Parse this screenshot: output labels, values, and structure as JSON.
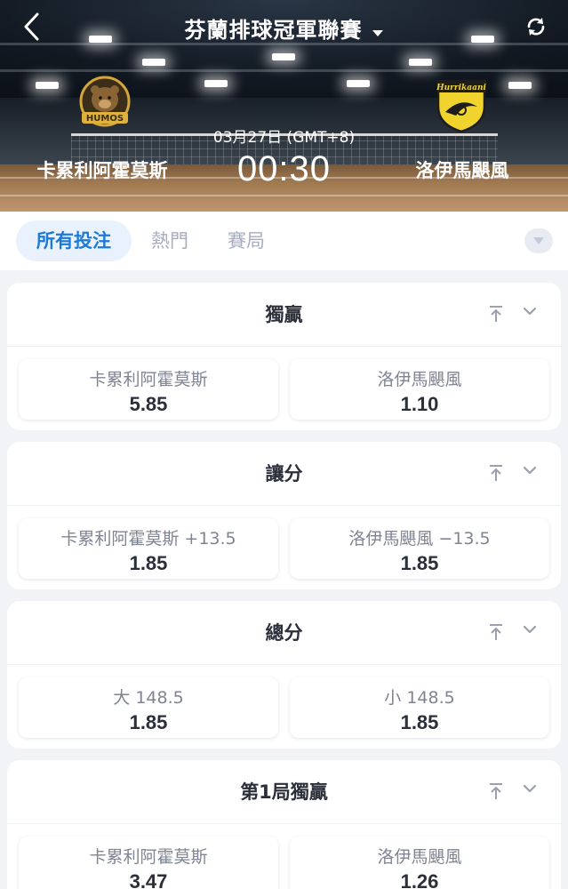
{
  "header": {
    "league_title": "芬蘭排球冠軍聯賽",
    "match_date": "03月27日 (GMT+8)",
    "match_time": "00:30",
    "home_team": "卡累利阿霍莫斯",
    "away_team": "洛伊馬颶風",
    "home_logo_text": "HUMOS",
    "away_logo_text": "Hurrikaani"
  },
  "tabs": [
    {
      "label": "所有投注",
      "active": true
    },
    {
      "label": "熱門",
      "active": false
    },
    {
      "label": "賽局",
      "active": false
    }
  ],
  "markets": [
    {
      "title": "獨贏",
      "options": [
        {
          "label": "卡累利阿霍莫斯",
          "odds": "5.85"
        },
        {
          "label": "洛伊馬颶風",
          "odds": "1.10"
        }
      ]
    },
    {
      "title": "讓分",
      "options": [
        {
          "label": "卡累利阿霍莫斯 +13.5",
          "odds": "1.85"
        },
        {
          "label": "洛伊馬颶風 −13.5",
          "odds": "1.85"
        }
      ]
    },
    {
      "title": "總分",
      "options": [
        {
          "label": "大 148.5",
          "odds": "1.85"
        },
        {
          "label": "小 148.5",
          "odds": "1.85"
        }
      ]
    },
    {
      "title": "第1局獨贏",
      "options": [
        {
          "label": "卡累利阿霍莫斯",
          "odds": "3.47"
        },
        {
          "label": "洛伊馬颶風",
          "odds": "1.26"
        }
      ]
    }
  ],
  "colors": {
    "accent": "#1d79d8",
    "tab_active_bg": "#e9f2fc",
    "page_bg": "#f2f3f7",
    "text_dark": "#2b2f3a",
    "text_muted": "#7f8493"
  },
  "icons": [
    "back-icon",
    "dropdown-caret-icon",
    "refresh-icon",
    "expand-tabs-icon",
    "pin-top-icon",
    "chevron-down-icon"
  ]
}
